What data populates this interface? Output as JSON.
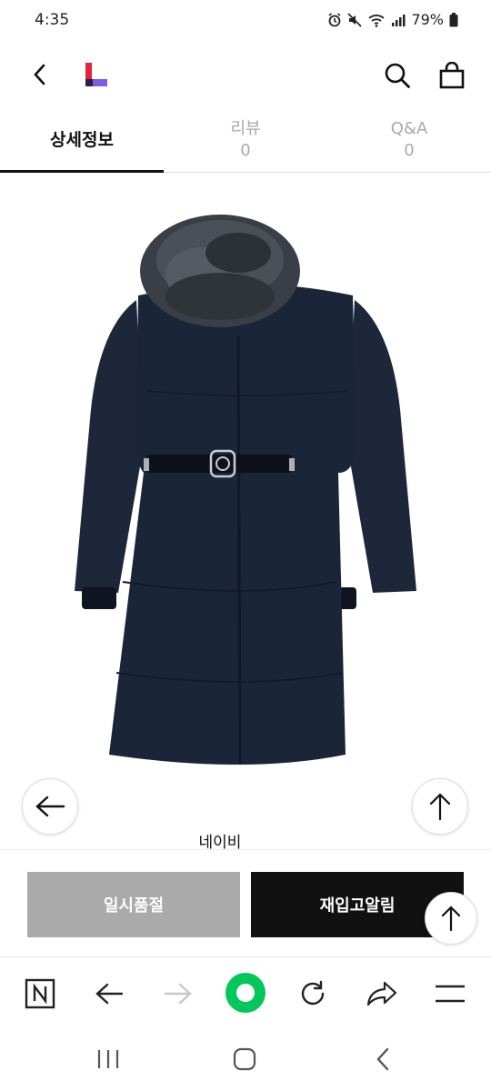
{
  "status_bar": {
    "time": "4:35",
    "battery": "79%"
  },
  "app": {
    "logo_icon": "lotte-l-logo-icon"
  },
  "tabs": [
    {
      "label": "상세정보",
      "count": ""
    },
    {
      "label": "리뷰",
      "count": "0"
    },
    {
      "label": "Q&A",
      "count": "0"
    }
  ],
  "product": {
    "color_label": "네이비",
    "image": "navy-fur-hood-long-padded-coat"
  },
  "actions": {
    "sold_out_label": "일시품절",
    "restock_label": "재입고알림"
  },
  "colors": {
    "sold_out_bg": "#aaaaaa",
    "restock_bg": "#111111",
    "accent_green": "#03c75a",
    "coat_navy": "#1b2538"
  }
}
